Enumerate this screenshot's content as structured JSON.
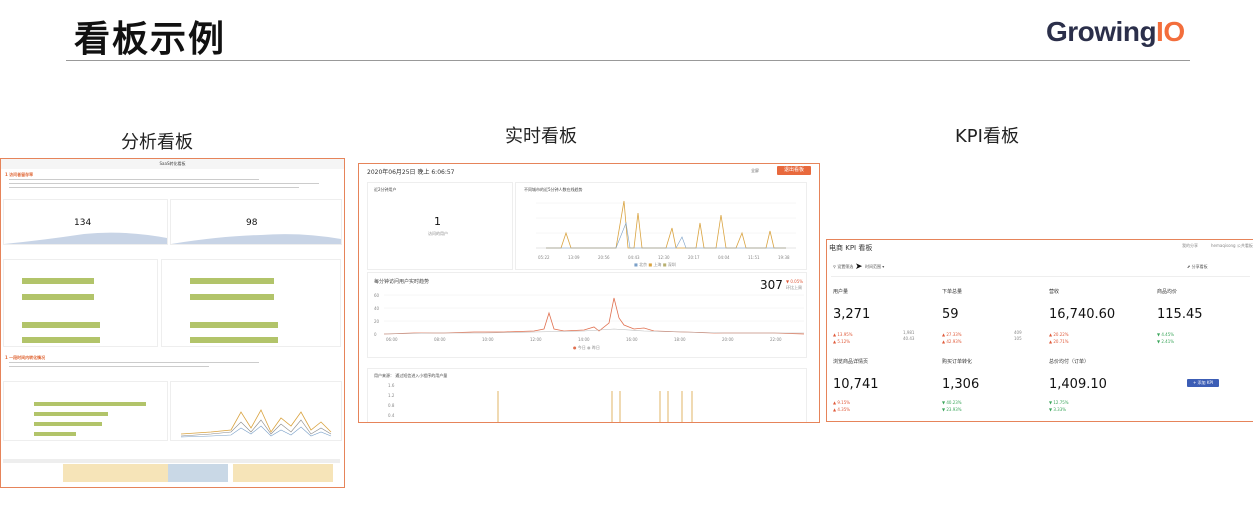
{
  "slide": {
    "title": "看板示例",
    "logo_main": "Growing",
    "logo_accent": "IO"
  },
  "captions": {
    "analysis": "分析看板",
    "realtime": "实时看板",
    "kpi": "KPI看板"
  },
  "analysis_board": {
    "header": "SaaS转化看板",
    "section1": "1 访问者留存率",
    "section2": "1 一段时间内转化情况",
    "stat1": "134",
    "stat2": "98"
  },
  "realtime_board": {
    "datetime": "2020年06月25日 晚上 6:06:57",
    "fullscreen_label": "全屏",
    "exit_label": "退出看板",
    "card1_title": "近2分钟用户",
    "card1_value": "1",
    "card1_sub": "访问的用户",
    "card2_title": "不同城市的近5分钟人数在线趋势",
    "card2_legend": [
      "北京",
      "上海",
      "深圳"
    ],
    "card2_xticks": [
      "05:22",
      "13:09",
      "20:56",
      "04:43",
      "12:30",
      "20:17",
      "04:04",
      "11:51",
      "19:38"
    ],
    "card3_title": "每分钟访问用户实时趋势",
    "card3_value": "307",
    "card3_delta": "▼ 0.05%",
    "card3_delta_sub": "环比上周",
    "card3_yticks": [
      "60",
      "40",
      "20",
      "0"
    ],
    "card3_xticks": [
      "06:00",
      "08:00",
      "10:00",
      "12:00",
      "14:00",
      "16:00",
      "18:00",
      "20:00",
      "22:00"
    ],
    "card3_legend": [
      "今日",
      "昨日"
    ],
    "card4_title": "用户来源： 通过短信进入小程序的用户量",
    "card4_yticks": [
      "1.6",
      "1.2",
      "0.8",
      "0.4"
    ]
  },
  "kpi_board": {
    "title": "电商 KPI 看板",
    "filter_label": "设置筛选",
    "time_label": "时间范围",
    "top_right_1": "我的分享",
    "top_right_2": "hemaqisong 公共看板",
    "share_label": "分享看板",
    "cards": [
      {
        "label": "用户量",
        "value": "3,271",
        "d1": "▲ 13.95%",
        "d2": "▲ 5.12%",
        "r1": "1,981",
        "r2": "40.43"
      },
      {
        "label": "下单总量",
        "value": "59",
        "d1": "▲ 27.33%",
        "d2": "▲ 42.93%",
        "r1": "409",
        "r2": "105"
      },
      {
        "label": "营收",
        "value": "16,740.60",
        "d1": "▲ 20.22%",
        "d2": "▲ 20.71%",
        "r1": "",
        "r2": ""
      },
      {
        "label": "商品均价",
        "value": "115.45",
        "d1": "▼ 4.45%",
        "d2": "▼ 2.41%",
        "r1": "",
        "r2": ""
      },
      {
        "label": "浏览商品详情页",
        "value": "10,741",
        "d1": "▲ 9.15%",
        "d2": "▲ 4.35%",
        "r1": "",
        "r2": ""
      },
      {
        "label": "购买订单转化",
        "value": "1,306",
        "d1": "▼ 40.23%",
        "d2": "▼ 23.93%",
        "r1": "",
        "r2": ""
      },
      {
        "label": "总价均付（订单）",
        "value": "1,409.10",
        "d1": "▼ 12.75%",
        "d2": "▼ 3.33%",
        "r1": "",
        "r2": ""
      }
    ],
    "add_kpi_label": "+ 添加 KPI"
  }
}
